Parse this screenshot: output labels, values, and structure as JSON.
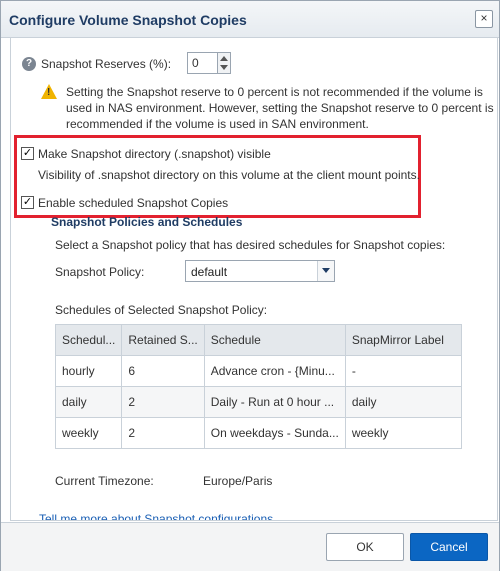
{
  "dialog": {
    "title": "Configure Volume Snapshot Copies",
    "close_glyph": "×"
  },
  "reserve": {
    "label": "Snapshot Reserves (%):",
    "value": "0",
    "warning": [
      "Setting the Snapshot reserve to 0 percent is not recommended if the volume is",
      "used in NAS environment. However, setting the Snapshot reserve to 0 percent is",
      "recommended if the volume is used in SAN environment."
    ]
  },
  "snapshot_dir": {
    "checked": true,
    "label": "Make Snapshot directory (.snapshot) visible",
    "description": "Visibility of .snapshot directory on this volume at the client mount points."
  },
  "scheduled": {
    "checked": true,
    "label": "Enable scheduled Snapshot Copies"
  },
  "policies": {
    "heading": "Snapshot Policies and Schedules",
    "instruction": "Select a Snapshot policy that has desired schedules for Snapshot copies:",
    "policy_label": "Snapshot Policy:",
    "policy_value": "default",
    "schedules_label": "Schedules of Selected Snapshot Policy:",
    "columns": [
      "Schedul...",
      "Retained S...",
      "Schedule",
      "SnapMirror Label"
    ],
    "rows": [
      [
        "hourly",
        "6",
        "Advance cron - {Minu...",
        "-"
      ],
      [
        "daily",
        "2",
        "Daily - Run at 0 hour ...",
        "daily"
      ],
      [
        "weekly",
        "2",
        "On weekdays - Sunda...",
        "weekly"
      ]
    ],
    "timezone_label": "Current Timezone:",
    "timezone_value": "Europe/Paris",
    "more_link": "Tell me more about Snapshot configurations"
  },
  "footer": {
    "ok_label": "OK",
    "cancel_label": "Cancel"
  },
  "icons": {
    "help": "help-icon",
    "warning": "warning-icon",
    "close": "close-icon",
    "dropdown": "chevron-down-icon"
  },
  "colors": {
    "highlight_border": "#e2212f",
    "primary_button": "#0b66c3",
    "heading": "#1f3c64",
    "link": "#1a5fb4"
  }
}
